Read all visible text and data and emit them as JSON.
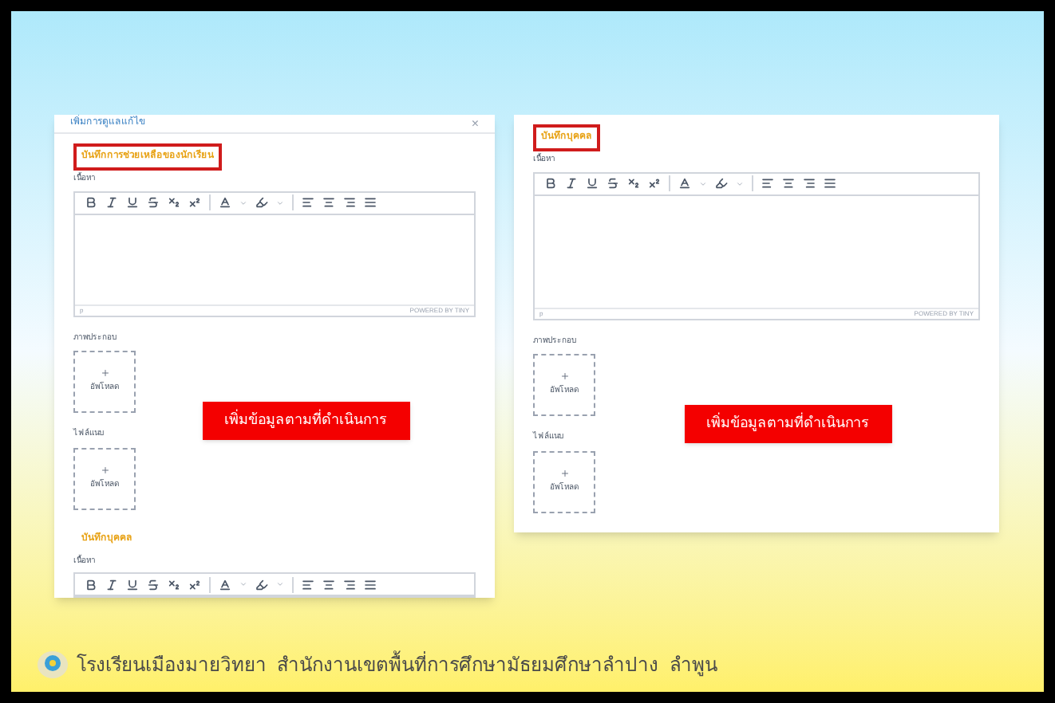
{
  "panels": [
    {
      "title": "เพิ่มการดูแลแก้ไข",
      "close": "×",
      "banner": "เพิ่มข้อมูลตามที่ดำเนินการ",
      "sections": [
        {
          "kind": "editor",
          "heading": "บันทึกการช่วยเหลือของนักเรียน",
          "highlighted": true,
          "label": "เนื้อหา",
          "status": "p",
          "branding": "POWERED BY TINY"
        },
        {
          "kind": "upload",
          "label": "ภาพประกอบ",
          "button": "อัพโหลด"
        },
        {
          "kind": "upload",
          "label": "ไฟล์แนบ",
          "button": "อัพโหลด"
        },
        {
          "kind": "editor",
          "heading": "บันทึกบุคคล",
          "highlighted": false,
          "label": "เนื้อหา"
        }
      ]
    },
    {
      "banner": "เพิ่มข้อมูลตามที่ดำเนินการ",
      "sections": [
        {
          "kind": "editor",
          "heading": "บันทึกบุคคล",
          "highlighted": true,
          "label": "เนื้อหา",
          "status": "p",
          "branding": "POWERED BY TINY"
        },
        {
          "kind": "upload",
          "label": "ภาพประกอบ",
          "button": "อัพโหลด"
        },
        {
          "kind": "upload",
          "label": "ไฟล์แนบ",
          "button": "อัพโหลด"
        }
      ]
    }
  ],
  "footer": "โรงเรียนเมืองมายวิทยา  สำนักงานเขตพื้นที่การศึกษามัธยมศึกษาลำปาง  ลำพูน"
}
